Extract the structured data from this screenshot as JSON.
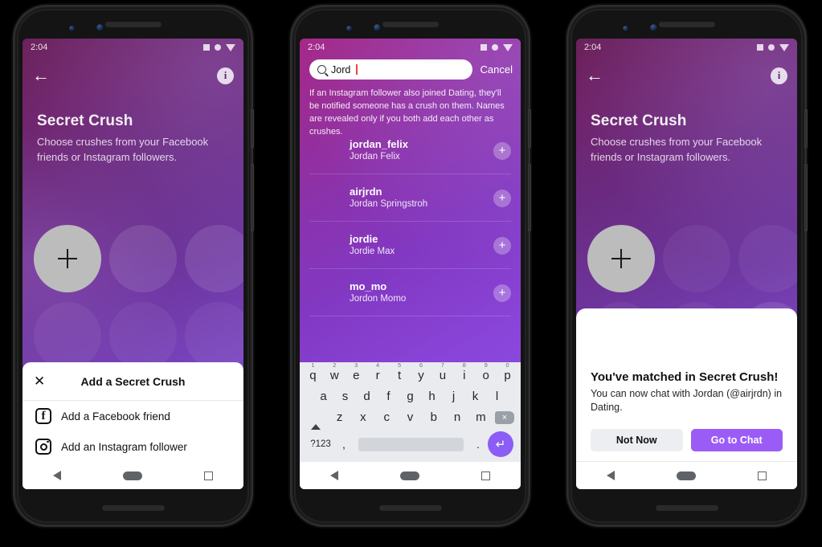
{
  "meta": {
    "background": "#000000",
    "accent": "#8b5cf6"
  },
  "status_bar": {
    "time": "2:04"
  },
  "phone1": {
    "nav": {
      "back_icon": "back-arrow-icon",
      "info_icon": "info-icon",
      "info_glyph": "i"
    },
    "headline": {
      "title": "Secret Crush",
      "subtitle": "Choose crushes from your Facebook friends or Instagram followers."
    },
    "sheet": {
      "close_icon": "close-icon",
      "title": "Add a Secret Crush",
      "items": [
        {
          "label": "Add a Facebook friend",
          "icon": "facebook-icon",
          "glyph": "f"
        },
        {
          "label": "Add an Instagram follower",
          "icon": "instagram-icon"
        }
      ]
    }
  },
  "phone2": {
    "search": {
      "value": "Jord",
      "icon": "search-icon",
      "cancel_label": "Cancel"
    },
    "blurb": "If an Instagram follower also joined Dating, they'll be notified someone has a crush on them. Names are revealed only if you both add each other as crushes.",
    "contacts": [
      {
        "username": "jordan_felix",
        "fullname": "Jordan Felix",
        "add_icon": "plus-icon",
        "add_glyph": "+"
      },
      {
        "username": "airjrdn",
        "fullname": "Jordan Springstroh",
        "add_icon": "plus-icon",
        "add_glyph": "+"
      },
      {
        "username": "jordie",
        "fullname": "Jordie Max",
        "add_icon": "plus-icon",
        "add_glyph": "+"
      },
      {
        "username": "mo_mo",
        "fullname": "Jordon Momo",
        "add_icon": "plus-icon",
        "add_glyph": "+"
      }
    ],
    "keyboard": {
      "row1": [
        {
          "key": "q",
          "num": "1"
        },
        {
          "key": "w",
          "num": "2"
        },
        {
          "key": "e",
          "num": "3"
        },
        {
          "key": "r",
          "num": "4"
        },
        {
          "key": "t",
          "num": "5"
        },
        {
          "key": "y",
          "num": "6"
        },
        {
          "key": "u",
          "num": "7"
        },
        {
          "key": "i",
          "num": "8"
        },
        {
          "key": "o",
          "num": "9"
        },
        {
          "key": "p",
          "num": "0"
        }
      ],
      "row2": [
        "a",
        "s",
        "d",
        "f",
        "g",
        "h",
        "j",
        "k",
        "l"
      ],
      "row3": [
        "z",
        "x",
        "c",
        "v",
        "b",
        "n",
        "m"
      ],
      "shift_icon": "shift-icon",
      "backspace_icon": "backspace-icon",
      "backspace_glyph": "×",
      "symbols_label": "?123",
      "comma": ",",
      "period": ".",
      "enter_icon": "enter-icon",
      "enter_glyph": "↵"
    }
  },
  "phone3": {
    "nav": {
      "back_icon": "back-arrow-icon",
      "info_icon": "info-icon",
      "info_glyph": "i"
    },
    "headline": {
      "title": "Secret Crush",
      "subtitle": "Choose crushes from your Facebook friends or Instagram followers."
    },
    "dialog": {
      "title": "You've matched in Secret Crush!",
      "subtitle": "You can now chat with Jordan (@airjrdn) in Dating.",
      "secondary_label": "Not Now",
      "primary_label": "Go to Chat"
    }
  },
  "android_nav": {
    "back_icon": "nav-back-icon",
    "home_icon": "nav-home-icon",
    "recents_icon": "nav-recents-icon"
  }
}
